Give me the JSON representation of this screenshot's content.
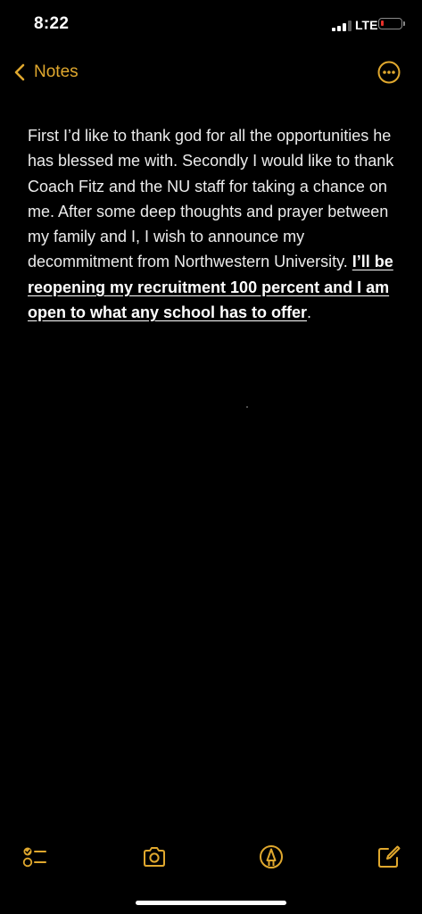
{
  "status_bar": {
    "time": "8:22",
    "network": "LTE",
    "battery_color": "#e8312a"
  },
  "nav": {
    "back_label": "Notes",
    "back_icon": "chevron-left-icon",
    "more_icon": "ellipsis-circle-icon",
    "accent_color": "#e0a82e"
  },
  "note": {
    "paragraph": "First I’d like to thank god for all the opportunities he has blessed me with. Secondly I would like to thank Coach Fitz and the NU staff for taking a chance on me. After some deep thoughts and prayer between my family and I, I wish to announce my decommitment from Northwestern University.",
    "emphasis": "I’ll be reopening my recruitment 100 percent and I am open to what any school has to offer",
    "end_punct": "."
  },
  "toolbar": {
    "icons": [
      "checklist-icon",
      "camera-icon",
      "markup-pen-icon",
      "compose-icon"
    ]
  }
}
